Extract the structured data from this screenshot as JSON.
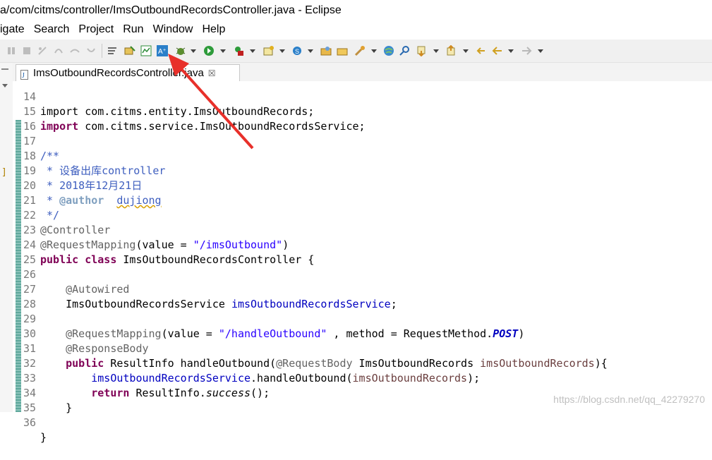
{
  "window": {
    "title": "a/com/citms/controller/ImsOutboundRecordsController.java - Eclipse"
  },
  "menu": [
    "igate",
    "Search",
    "Project",
    "Run",
    "Window",
    "Help"
  ],
  "toolbar": {
    "icons": [
      "skip-icon",
      "stop-icon",
      "disconnect-icon",
      "step-into-icon",
      "step-over-icon",
      "step-return-icon",
      "use-step-filters-icon",
      "open-type-icon",
      "edit-icon",
      "chart-icon",
      "format-icon",
      "debug-icon",
      "run-icon",
      "external-tools-icon",
      "new-wizard-icon",
      "new-class-icon",
      "open-folder-icon",
      "open-project-icon",
      "search-icon",
      "globe-icon",
      "search-refs-icon",
      "next-annotation-icon",
      "prev-annotation-icon",
      "last-edit-icon",
      "back-icon",
      "forward-icon"
    ]
  },
  "editor": {
    "tab_label": "ImsOutboundRecordsController.java",
    "close_glyph": "☒",
    "lines": [
      {
        "n": "14",
        "t": "import com.citms.entity.ImsOutboundRecords;"
      },
      {
        "n": "15",
        "t": "import com.citms.service.ImsOutboundRecordsService;"
      },
      {
        "n": "16",
        "t": ""
      },
      {
        "n": "17",
        "t": "/**"
      },
      {
        "n": "18",
        "t": " * 设备出库controller"
      },
      {
        "n": "19",
        "t": " * 2018年12月21日"
      },
      {
        "n": "20",
        "t": " * @author  dujiong"
      },
      {
        "n": "21",
        "t": " */"
      },
      {
        "n": "22",
        "t": "@Controller"
      },
      {
        "n": "23",
        "t": "@RequestMapping(value = \"/imsOutbound\")"
      },
      {
        "n": "24",
        "t": "public class ImsOutboundRecordsController {"
      },
      {
        "n": "25",
        "t": ""
      },
      {
        "n": "26",
        "t": "    @Autowired"
      },
      {
        "n": "27",
        "t": "    ImsOutboundRecordsService imsOutboundRecordsService;"
      },
      {
        "n": "28",
        "t": ""
      },
      {
        "n": "29",
        "t": "    @RequestMapping(value = \"/handleOutbound\" , method = RequestMethod.POST)"
      },
      {
        "n": "30",
        "t": "    @ResponseBody"
      },
      {
        "n": "31",
        "t": "    public ResultInfo handleOutbound(@RequestBody ImsOutboundRecords imsOutboundRecords){"
      },
      {
        "n": "32",
        "t": "        imsOutboundRecordsService.handleOutbound(imsOutboundRecords);"
      },
      {
        "n": "33",
        "t": "        return ResultInfo.success();"
      },
      {
        "n": "34",
        "t": "    }"
      },
      {
        "n": "35",
        "t": ""
      },
      {
        "n": "36",
        "t": "}"
      }
    ]
  },
  "watermark": "https://blog.csdn.net/qq_42279270",
  "colors": {
    "keyword": "#7f0055",
    "annotation": "#646464",
    "string": "#2a00ff",
    "comment": "#3f5fbf",
    "field": "#0000c0",
    "arrow": "#e8302a"
  }
}
